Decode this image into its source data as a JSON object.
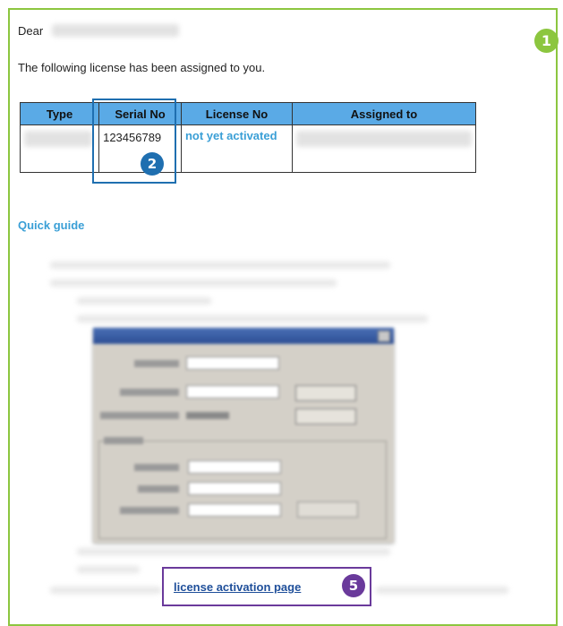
{
  "email": {
    "greeting": "Dear",
    "intro": "The following license has been assigned to you.",
    "table": {
      "headers": [
        "Type",
        "Serial No",
        "License No",
        "Assigned to"
      ],
      "row": {
        "serial_no": "123456789",
        "license_no": "not yet activated"
      }
    },
    "quick_guide": "Quick guide",
    "activation_link": "license activation page"
  },
  "step_badges": {
    "step1": "1",
    "step2": "2",
    "step5": "5"
  },
  "colors": {
    "frame_green": "#8cc63f",
    "header_blue": "#5aaae6",
    "link_blue": "#3a9fd6",
    "highlight_blue": "#1f6fb0",
    "highlight_purple": "#6a3a9b"
  }
}
